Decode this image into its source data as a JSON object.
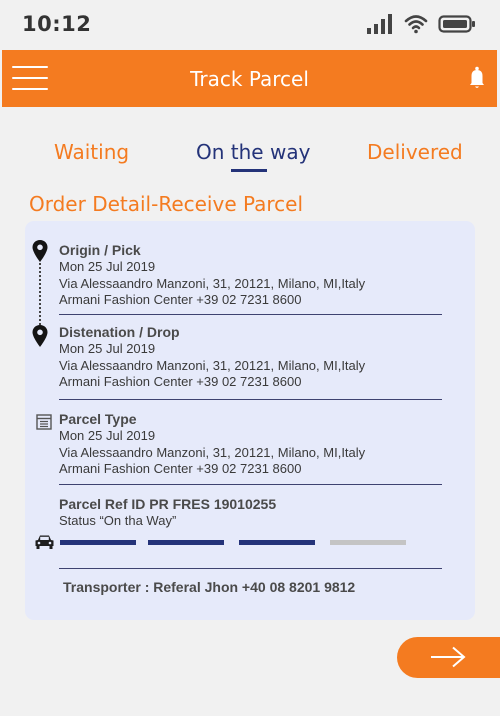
{
  "status_bar": {
    "time": "10:12"
  },
  "header": {
    "title": "Track Parcel"
  },
  "tabs": [
    {
      "label": "Waiting",
      "active": false
    },
    {
      "label": "On the way",
      "active": true
    },
    {
      "label": "Delivered",
      "active": false
    }
  ],
  "section_title": "Order Detail-Receive Parcel",
  "origin": {
    "title": "Origin / Pick",
    "date": "Mon 25 Jul 2019",
    "address": "Via Alessaandro Manzoni, 31, 20121, Milano, MI,Italy",
    "contact": "Armani Fashion Center +39 02 7231 8600"
  },
  "destination": {
    "title": "Distenation / Drop",
    "date": "Mon 25 Jul 2019",
    "address": "Via Alessaandro Manzoni, 31, 20121, Milano, MI,Italy",
    "contact": "Armani Fashion Center +39 02 7231 8600"
  },
  "parcel_type": {
    "title": "Parcel Type",
    "date": "Mon 25 Jul 2019",
    "address": "Via Alessaandro Manzoni, 31, 20121, Milano, MI,Italy",
    "contact": "Armani Fashion Center +39 02 7231 8600"
  },
  "parcel_ref": {
    "title": "Parcel Ref ID PR FRES  19010255",
    "status": "Status “On tha Way”",
    "progress": {
      "completed_steps": 3,
      "total_steps": 4
    }
  },
  "transporter": "Transporter : Referal Jhon +40 08 8201 9812",
  "colors": {
    "accent": "#f47b20",
    "primary": "#243379",
    "card_bg": "#e6eafa",
    "progress_done": "#243379",
    "progress_todo": "#c4c4c4"
  },
  "icons": {
    "menu": "menu-icon",
    "bell": "bell-icon",
    "pin": "map-pin-icon",
    "parcel": "package-icon",
    "vehicle": "car-icon",
    "next": "arrow-right-icon"
  }
}
